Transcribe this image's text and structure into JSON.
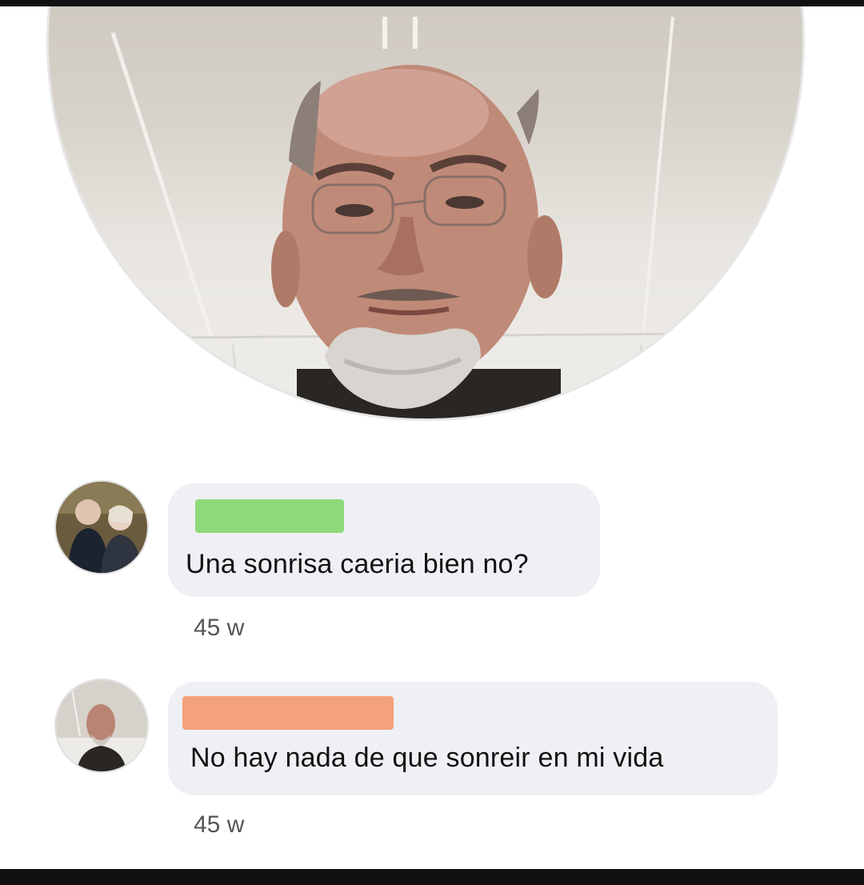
{
  "post": {
    "photo_icon": "profile-photo"
  },
  "colors": {
    "bubble": "#eef0f4",
    "name_redaction_1": "#8fd97a",
    "name_redaction_2": "#f4a27b",
    "text": "#111111",
    "timestamp": "#555555"
  },
  "comments": [
    {
      "text": "Una sonrisa caeria bien no?",
      "time": "45 w",
      "avatar_icon": "couple-photo-avatar"
    },
    {
      "text": "No hay nada de que sonreir en mi vida",
      "time": "45 w",
      "avatar_icon": "man-selfie-avatar"
    }
  ]
}
